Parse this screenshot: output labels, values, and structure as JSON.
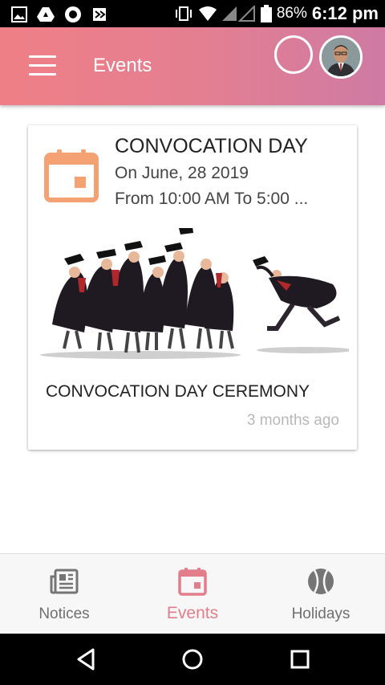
{
  "status_bar": {
    "battery_percent": "86%",
    "time": "6:12 pm"
  },
  "app_bar": {
    "title": "Events"
  },
  "event": {
    "title": "CONVOCATION DAY",
    "date": "On June, 28 2019",
    "time": "From 10:00 AM To 5:00 ...",
    "description": "CONVOCATION DAY CEREMONY",
    "posted": "3 months ago",
    "icon": "calendar-icon"
  },
  "bottom_nav": {
    "items": [
      {
        "label": "Notices",
        "icon": "newspaper-icon"
      },
      {
        "label": "Events",
        "icon": "calendar-icon"
      },
      {
        "label": "Holidays",
        "icon": "tennis-ball-icon"
      }
    ],
    "active_index": 1
  },
  "colors": {
    "accent": "#e27d8c",
    "calendar_icon": "#f4a273",
    "appbar_start": "#ef7f86",
    "appbar_end": "#cf7aa4"
  }
}
